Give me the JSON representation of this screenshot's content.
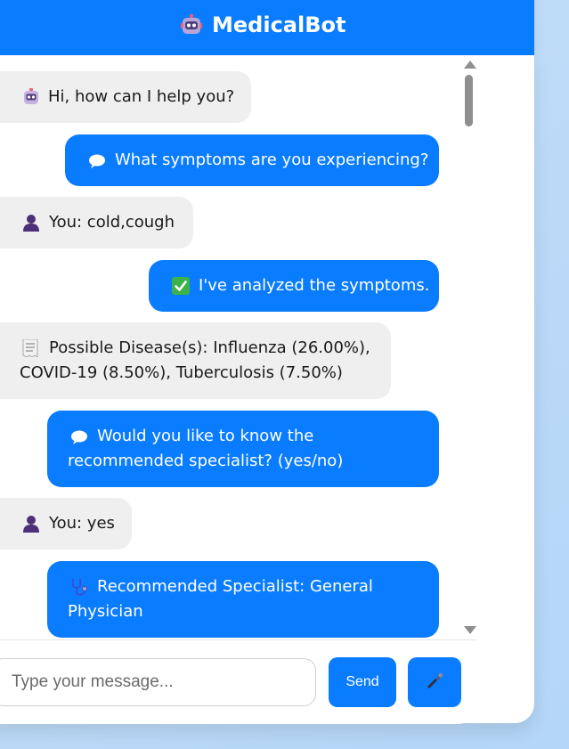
{
  "header": {
    "title": "MedicalBot",
    "icon": "robot-icon"
  },
  "colors": {
    "accent": "#0a7cff",
    "user_bubble": "#efefef",
    "background": "#b4d6f8"
  },
  "messages": [
    {
      "role": "user",
      "icon": "robot-face-icon",
      "text": "Hi, how can I help you?"
    },
    {
      "role": "bot",
      "icon": "speech-bubble-icon",
      "text": "What symptoms are you experiencing?"
    },
    {
      "role": "user",
      "icon": "person-icon",
      "text": "You: cold,cough"
    },
    {
      "role": "bot",
      "icon": "check-box-icon",
      "text": "I've analyzed the symptoms."
    },
    {
      "role": "user",
      "icon": "receipt-icon",
      "text": "Possible Disease(s): Influenza (26.00%), COVID-19 (8.50%), Tuberculosis (7.50%)"
    },
    {
      "role": "bot",
      "icon": "speech-bubble-icon",
      "text": "Would you like to know the recommended specialist? (yes/no)"
    },
    {
      "role": "user",
      "icon": "person-icon",
      "text": "You: yes"
    },
    {
      "role": "bot",
      "icon": "stethoscope-icon",
      "text": "Recommended Specialist: General Physician"
    }
  ],
  "input": {
    "placeholder": "Type your message...",
    "value": ""
  },
  "buttons": {
    "send_label": "Send",
    "mic_icon": "microphone-icon"
  }
}
